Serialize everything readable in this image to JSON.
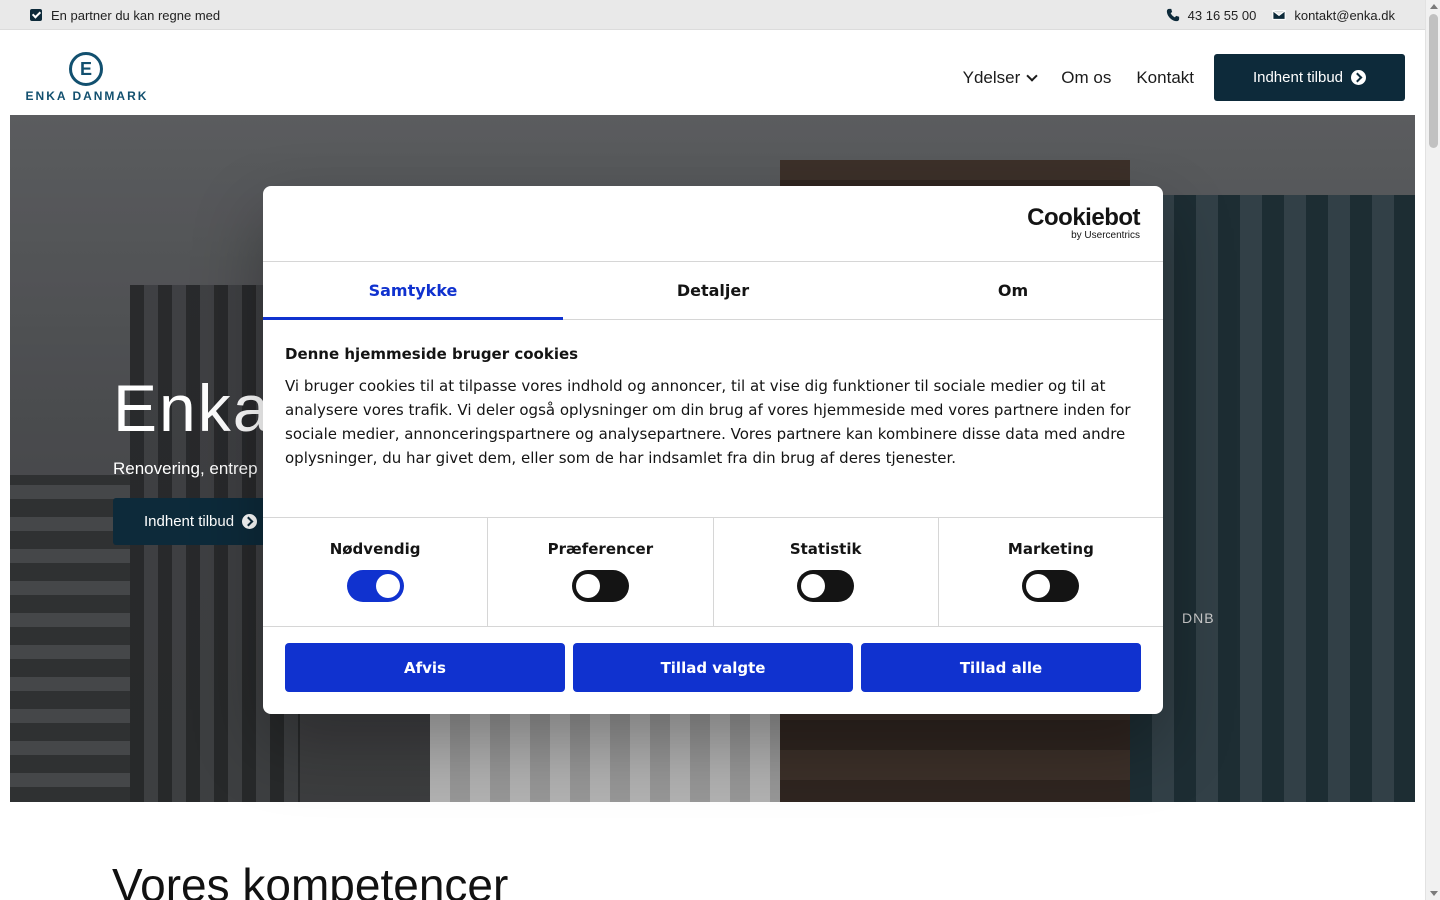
{
  "topbar": {
    "tagline": "En partner du kan regne med",
    "phone": "43 16 55 00",
    "email": "kontakt@enka.dk"
  },
  "header": {
    "logo_letter": "E",
    "logo_text": "ENKA DANMARK",
    "nav": [
      {
        "label": "Ydelser"
      },
      {
        "label": "Om os"
      },
      {
        "label": "Kontakt"
      }
    ],
    "cta_label": "Indhent tilbud"
  },
  "hero": {
    "title": "Enka",
    "subtitle": "Renovering, entrep",
    "button_label": "Indhent tilbud",
    "sign_text": "DNB"
  },
  "section": {
    "title": "Vores kompetencer"
  },
  "cookie_dialog": {
    "brand": "Cookiebot",
    "brand_sub": "by Usercentrics",
    "tabs": [
      {
        "label": "Samtykke",
        "active": true
      },
      {
        "label": "Detaljer",
        "active": false
      },
      {
        "label": "Om",
        "active": false
      }
    ],
    "heading": "Denne hjemmeside bruger cookies",
    "text": "Vi bruger cookies til at tilpasse vores indhold og annoncer, til at vise dig funktioner til sociale medier og til at analysere vores trafik. Vi deler også oplysninger om din brug af vores hjemmeside med vores partnere inden for sociale medier, annonceringspartnere og analysepartnere. Vores partnere kan kombinere disse data med andre oplysninger, du har givet dem, eller som de har indsamlet fra din brug af deres tjenester.",
    "toggles": [
      {
        "label": "Nødvendig",
        "on": true
      },
      {
        "label": "Præferencer",
        "on": false
      },
      {
        "label": "Statistik",
        "on": false
      },
      {
        "label": "Marketing",
        "on": false
      }
    ],
    "buttons": {
      "deny": "Afvis",
      "allow_selected": "Tillad valgte",
      "allow_all": "Tillad alle"
    },
    "accent_color": "#1032cf"
  },
  "colors": {
    "brand_dark": "#0d2a3a",
    "logo_blue": "#12506f"
  }
}
